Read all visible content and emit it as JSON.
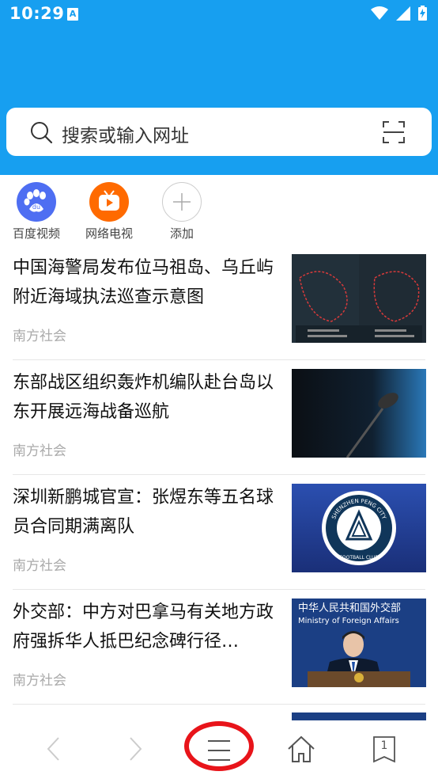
{
  "status_bar": {
    "time": "10:29",
    "notification_badge": "A",
    "icons": [
      "wifi-icon",
      "signal-icon",
      "battery-charging-icon"
    ]
  },
  "search": {
    "placeholder": "搜索或输入网址",
    "icons": [
      "search-icon",
      "scan-icon"
    ]
  },
  "quick_links": [
    {
      "label": "百度视频",
      "icon": "baidu-paw-icon",
      "color": "#4e6ef2"
    },
    {
      "label": "网络电视",
      "icon": "tv-icon",
      "color": "#ff6a00"
    },
    {
      "label": "添加",
      "icon": "plus-icon",
      "color": "#ffffff"
    }
  ],
  "news": [
    {
      "title": "中国海警局发布位马祖岛、乌丘屿附近海域执法巡查示意图",
      "source": "南方社会",
      "thumb": "map-thumbnail"
    },
    {
      "title": "东部战区组织轰炸机编队赴台岛以东开展远海战备巡航",
      "source": "南方社会",
      "thumb": "microphone-thumbnail"
    },
    {
      "title": "深圳新鹏城官宣：张煜东等五名球员合同期满离队",
      "source": "南方社会",
      "thumb": "club-logo-thumbnail"
    },
    {
      "title": "外交部：中方对巴拿马有关地方政府强拆华人抵巴纪念碑行径…",
      "source": "南方社会",
      "thumb": "press-conference-thumbnail"
    }
  ],
  "thumb_text": {
    "club_name": "SHENZHEN PENG CITY",
    "club_sub": "FOOTBALL CLUB",
    "mfa_banner": "中华人民共和国外交部",
    "mfa_banner_en": "Ministry of Foreign Affairs"
  },
  "bottom_nav": {
    "tab_count": "1",
    "icons": [
      "back-icon",
      "forward-icon",
      "menu-icon",
      "home-icon",
      "tabs-icon"
    ]
  },
  "colors": {
    "header": "#179ff0",
    "highlight": "#e8141a"
  }
}
